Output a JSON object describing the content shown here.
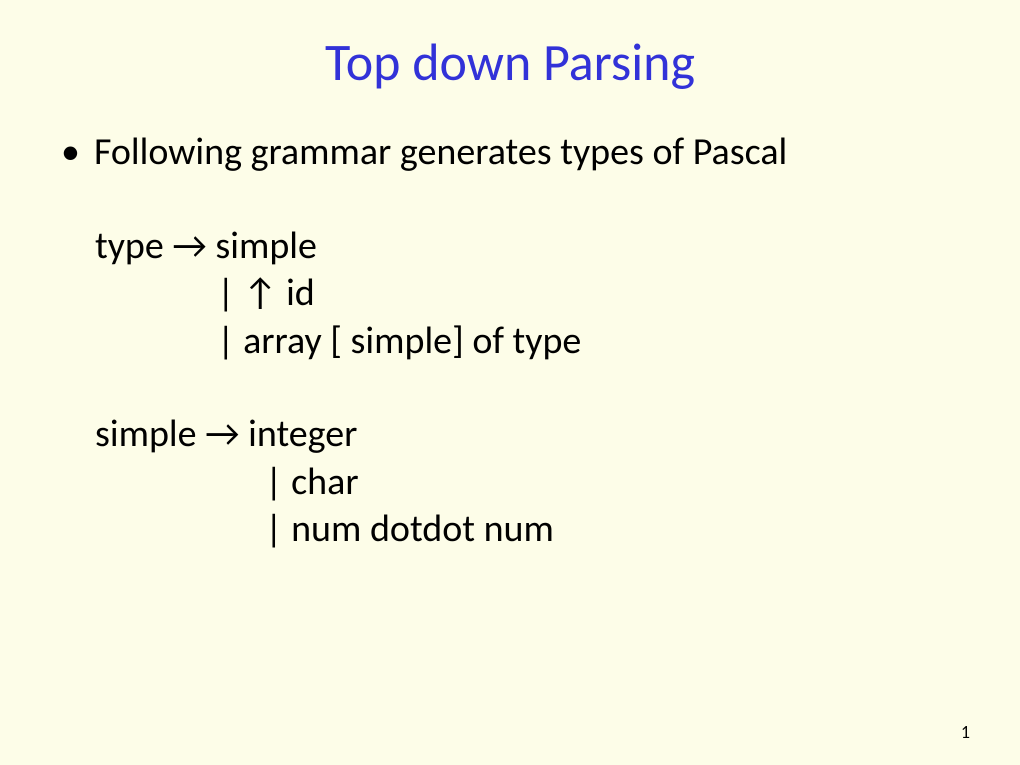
{
  "title": "Top down Parsing",
  "bullet_symbol": "•",
  "bullet_text": "Following grammar generates types of Pascal",
  "grammar": {
    "rule1_line1": "type → simple",
    "rule1_line2": "| ↑ id",
    "rule1_line3": "| array [ simple] of type",
    "rule2_line1": "simple → integer",
    "rule2_line2": "| char",
    "rule2_line3": "| num dotdot num"
  },
  "page_number": "1"
}
